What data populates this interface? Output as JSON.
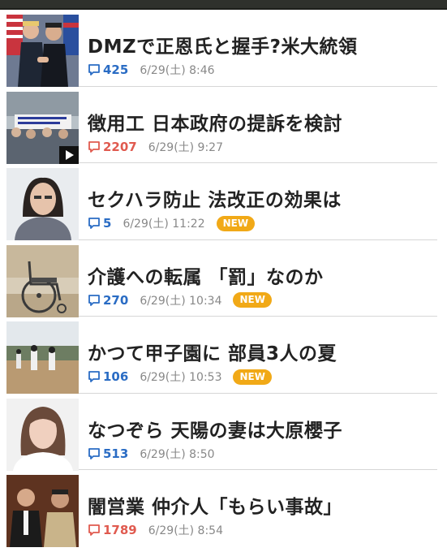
{
  "news": [
    {
      "title": "DMZで正恩氏と握手?米大統領",
      "comments": "425",
      "comment_color": "blue",
      "date": "6/29(土) 8:46",
      "badge": "",
      "thumb": "handshake-photo",
      "video": false
    },
    {
      "title": "徴用工 日本政府の提訴を検討",
      "comments": "2207",
      "comment_color": "red",
      "date": "6/29(土) 9:27",
      "badge": "",
      "thumb": "protest-photo",
      "video": true
    },
    {
      "title": "セクハラ防止 法改正の効果は",
      "comments": "5",
      "comment_color": "blue",
      "date": "6/29(土) 11:22",
      "badge": "NEW",
      "thumb": "woman-portrait",
      "video": false
    },
    {
      "title": "介護への転属 「罰」なのか",
      "comments": "270",
      "comment_color": "blue",
      "date": "6/29(土) 10:34",
      "badge": "NEW",
      "thumb": "wheelchair-photo",
      "video": false
    },
    {
      "title": "かつて甲子園に 部員3人の夏",
      "comments": "106",
      "comment_color": "blue",
      "date": "6/29(土) 10:53",
      "badge": "NEW",
      "thumb": "baseball-photo",
      "video": false
    },
    {
      "title": "なつぞら 天陽の妻は大原櫻子",
      "comments": "513",
      "comment_color": "blue",
      "date": "6/29(土) 8:50",
      "badge": "",
      "thumb": "actress-portrait",
      "video": false
    },
    {
      "title": "闇営業 仲介人「もらい事故」",
      "comments": "1789",
      "comment_color": "red",
      "date": "6/29(土) 8:54",
      "badge": "",
      "thumb": "comedians-photo",
      "video": false
    }
  ],
  "colors": {
    "blue": "#2a6cc4",
    "red": "#e05a4f",
    "badge": "#f1a917"
  }
}
